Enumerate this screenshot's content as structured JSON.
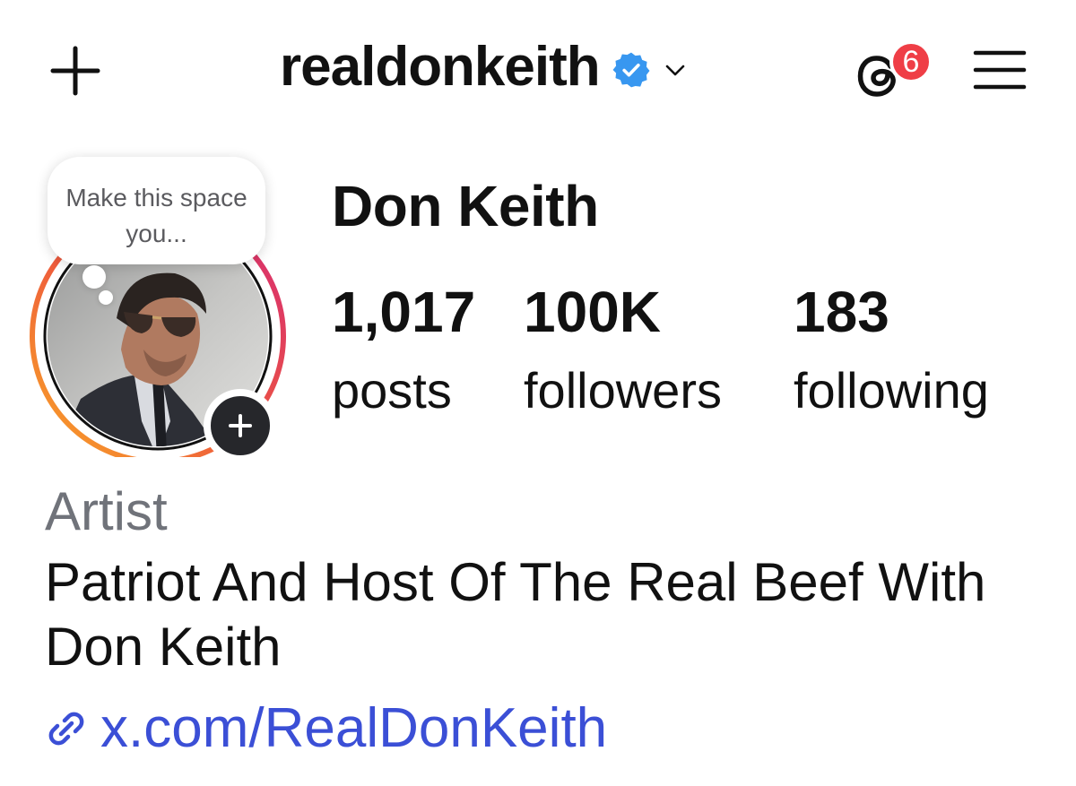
{
  "header": {
    "username": "realdonkeith",
    "notification_count": "6"
  },
  "avatar": {
    "note_text": "Make this space you..."
  },
  "profile": {
    "display_name": "Don Keith",
    "stats": [
      {
        "value": "1,017",
        "label": "posts"
      },
      {
        "value": "100K",
        "label": "followers"
      },
      {
        "value": "183",
        "label": "following"
      }
    ],
    "category": "Artist",
    "bio": "Patriot And Host Of The Real Beef With Don Keith",
    "link": "x.com/RealDonKeith"
  },
  "colors": {
    "verified": "#3897f0",
    "badge": "#ef3e46",
    "link": "#3b4fd6",
    "category": "#70737a",
    "story_ring_start": "#f9a826",
    "story_ring_end": "#d62976"
  },
  "icons": {
    "create": "plus-icon",
    "verified": "verified-badge-icon",
    "account_switch": "chevron-down-icon",
    "threads": "threads-icon",
    "menu": "hamburger-menu-icon",
    "add_story": "plus-icon",
    "link": "link-icon"
  }
}
